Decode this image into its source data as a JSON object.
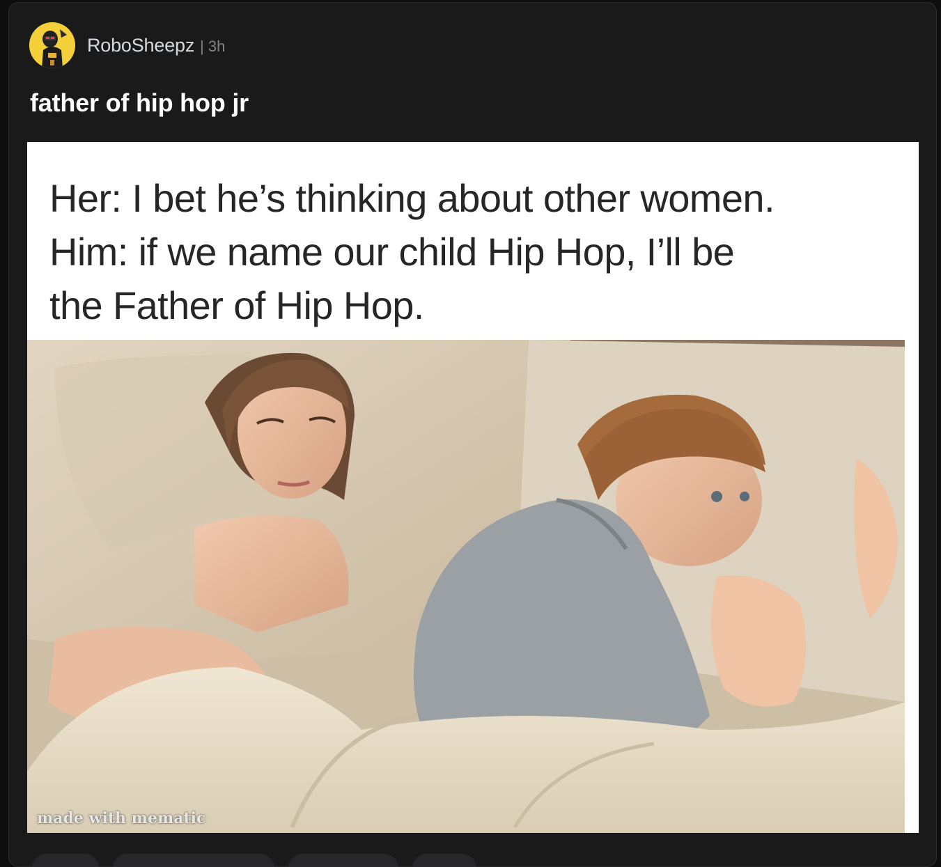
{
  "post": {
    "author": "RoboSheepz",
    "separator": "|",
    "time": "3h",
    "title": "father of hip hop jr"
  },
  "meme": {
    "caption_lines": [
      "Her: I bet he’s thinking about other women.",
      "Him: if we name our child Hip Hop, I’ll be",
      "the Father of Hip Hop."
    ],
    "watermark": "made with mematic"
  },
  "colors": {
    "card_bg": "#1a1a1b",
    "page_bg": "#0e0e0f",
    "avatar_bg": "#f4d13a",
    "title": "#ffffff",
    "meta": "#818384"
  },
  "icons": {
    "avatar": "robot-character-avatar"
  }
}
